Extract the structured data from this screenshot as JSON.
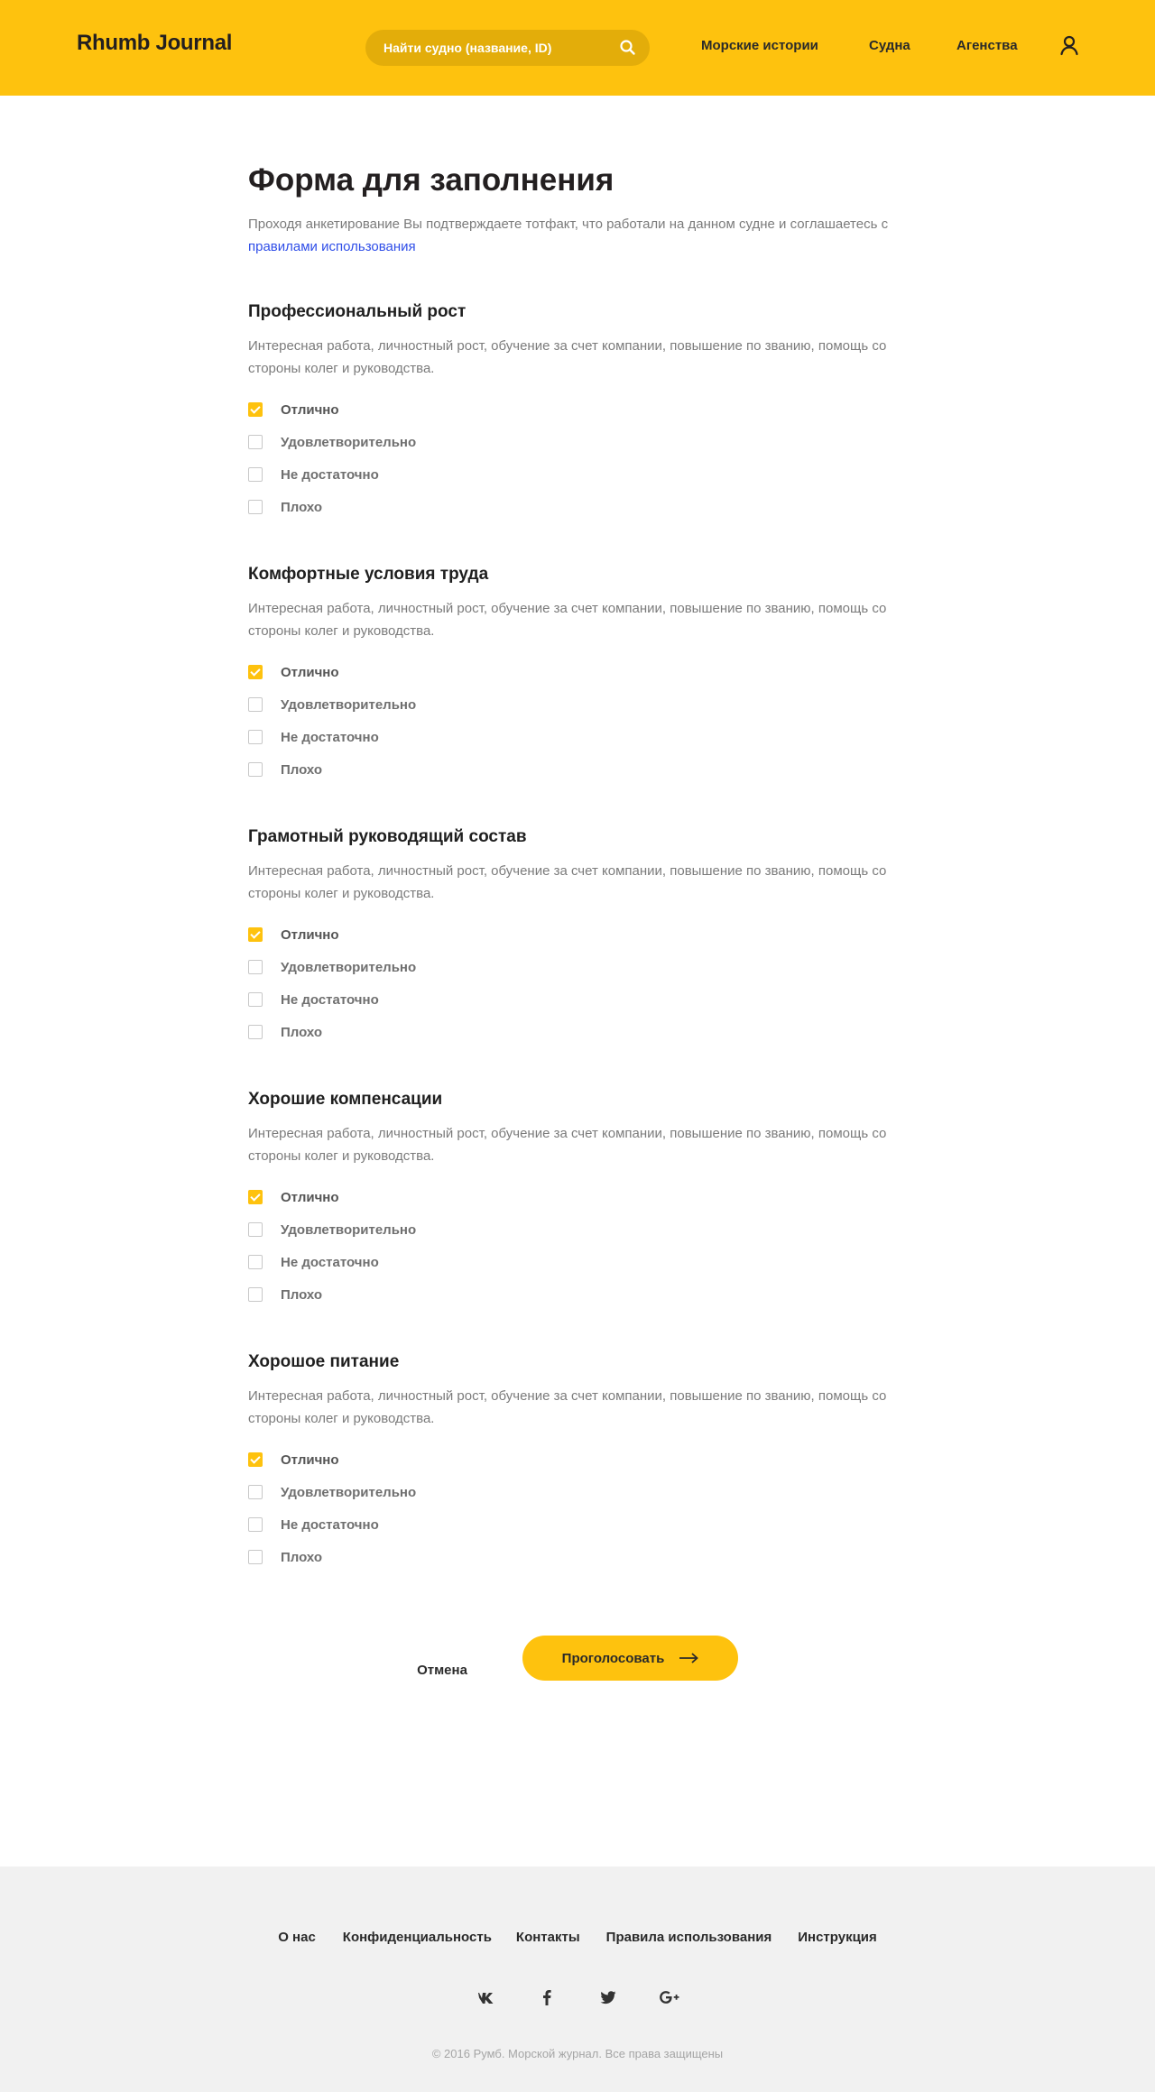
{
  "header": {
    "logo": "Rhumb Journal",
    "search_placeholder": "Найти судно (название, ID)",
    "nav": [
      "Морские истории",
      "Судна",
      "Агенства"
    ]
  },
  "page": {
    "title": "Форма для заполнения",
    "intro_text": "Проходя анкетирование Вы подтверждаете тотфакт, что работали на данном судне и соглашаетесь с ",
    "intro_link": "правилами использования"
  },
  "sections": [
    {
      "title": "Профессиональный рост",
      "description": "Интересная работа, личностный рост, обучение за счет компании, повышение по званию, помощь со стороны колег и руководства.",
      "options": [
        "Отлично",
        "Удовлетворительно",
        "Не достаточно",
        "Плохо"
      ],
      "selected": 0
    },
    {
      "title": "Комфортные условия труда",
      "description": "Интересная работа, личностный рост, обучение за счет компании, повышение по званию, помощь со стороны колег и руководства.",
      "options": [
        "Отлично",
        "Удовлетворительно",
        "Не достаточно",
        "Плохо"
      ],
      "selected": 0
    },
    {
      "title": "Грамотный руководящий состав",
      "description": "Интересная работа, личностный рост, обучение за счет компании, повышение по званию, помощь со стороны колег и руководства.",
      "options": [
        "Отлично",
        "Удовлетворительно",
        "Не достаточно",
        "Плохо"
      ],
      "selected": 0
    },
    {
      "title": "Хорошие компенсации",
      "description": "Интересная работа, личностный рост, обучение за счет компании, повышение по званию, помощь со стороны колег и руководства.",
      "options": [
        "Отлично",
        "Удовлетворительно",
        "Не достаточно",
        "Плохо"
      ],
      "selected": 0
    },
    {
      "title": "Хорошое питание",
      "description": "Интересная работа, личностный рост, обучение за счет компании, повышение по званию, помощь со стороны колег и руководства.",
      "options": [
        "Отлично",
        "Удовлетворительно",
        "Не достаточно",
        "Плохо"
      ],
      "selected": 0
    }
  ],
  "actions": {
    "cancel": "Отмена",
    "submit": "Проголосовать"
  },
  "footer": {
    "links": [
      "О нас",
      "Конфиденциальность",
      "Контакты",
      "Правила использования",
      "Инструкция"
    ],
    "social": [
      "vk-icon",
      "facebook-icon",
      "twitter-icon",
      "google-plus-icon"
    ],
    "copyright": "© 2016 Румб. Морской журнал. Все права защищены"
  },
  "colors": {
    "accent": "#fec20e",
    "link": "#2f4ee8",
    "footer_bg": "#f1f1f1"
  }
}
